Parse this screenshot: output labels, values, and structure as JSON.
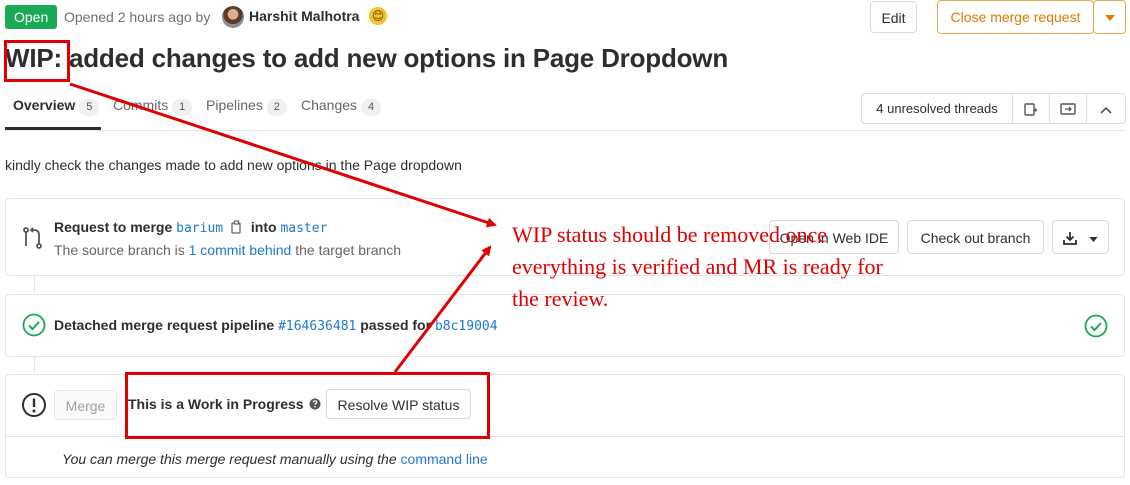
{
  "header": {
    "status": "Open",
    "opened_text": "Opened 2 hours ago by",
    "author": "Harshit Malhotra",
    "emoji": "😊",
    "edit_label": "Edit",
    "close_label": "Close merge request",
    "close_dropdown_icon": "chevron-down-icon"
  },
  "title": {
    "prefix": "WIP:",
    "text": " added changes to add new options in Page Dropdown"
  },
  "tabs": [
    {
      "label": "Overview",
      "count": "5"
    },
    {
      "label": "Commits",
      "count": "1"
    },
    {
      "label": "Pipelines",
      "count": "2"
    },
    {
      "label": "Changes",
      "count": "4"
    }
  ],
  "threads": {
    "label": "4 unresolved threads"
  },
  "description": "kindly check the changes made to add new options in the Page dropdown",
  "merge_request": {
    "request_label": "Request to merge",
    "source_branch": "barium",
    "into_label": "into",
    "target_branch": "master",
    "behind_prefix": "The source branch is",
    "behind_link": "1 commit behind",
    "behind_suffix": "the target branch",
    "open_web_ide": "Open in Web IDE",
    "check_out": "Check out branch"
  },
  "pipeline": {
    "label": "Detached merge request pipeline",
    "id": "#164636481",
    "passed_for": "passed for",
    "commit": "b8c19004"
  },
  "wip": {
    "merge_label": "Merge",
    "wip_text": "This is a Work in Progress",
    "resolve_label": "Resolve WIP status",
    "manual_text": "You can merge this merge request manually using the",
    "command_line": "command line"
  },
  "annotation": {
    "text": "WIP status should be removed once everything is verified and MR is ready for the review.",
    "color": "#e00000"
  },
  "colors": {
    "open_badge": "#1aaa55",
    "link": "#1f78d1",
    "close_button": "#e07a00",
    "success": "#1aaa55"
  }
}
